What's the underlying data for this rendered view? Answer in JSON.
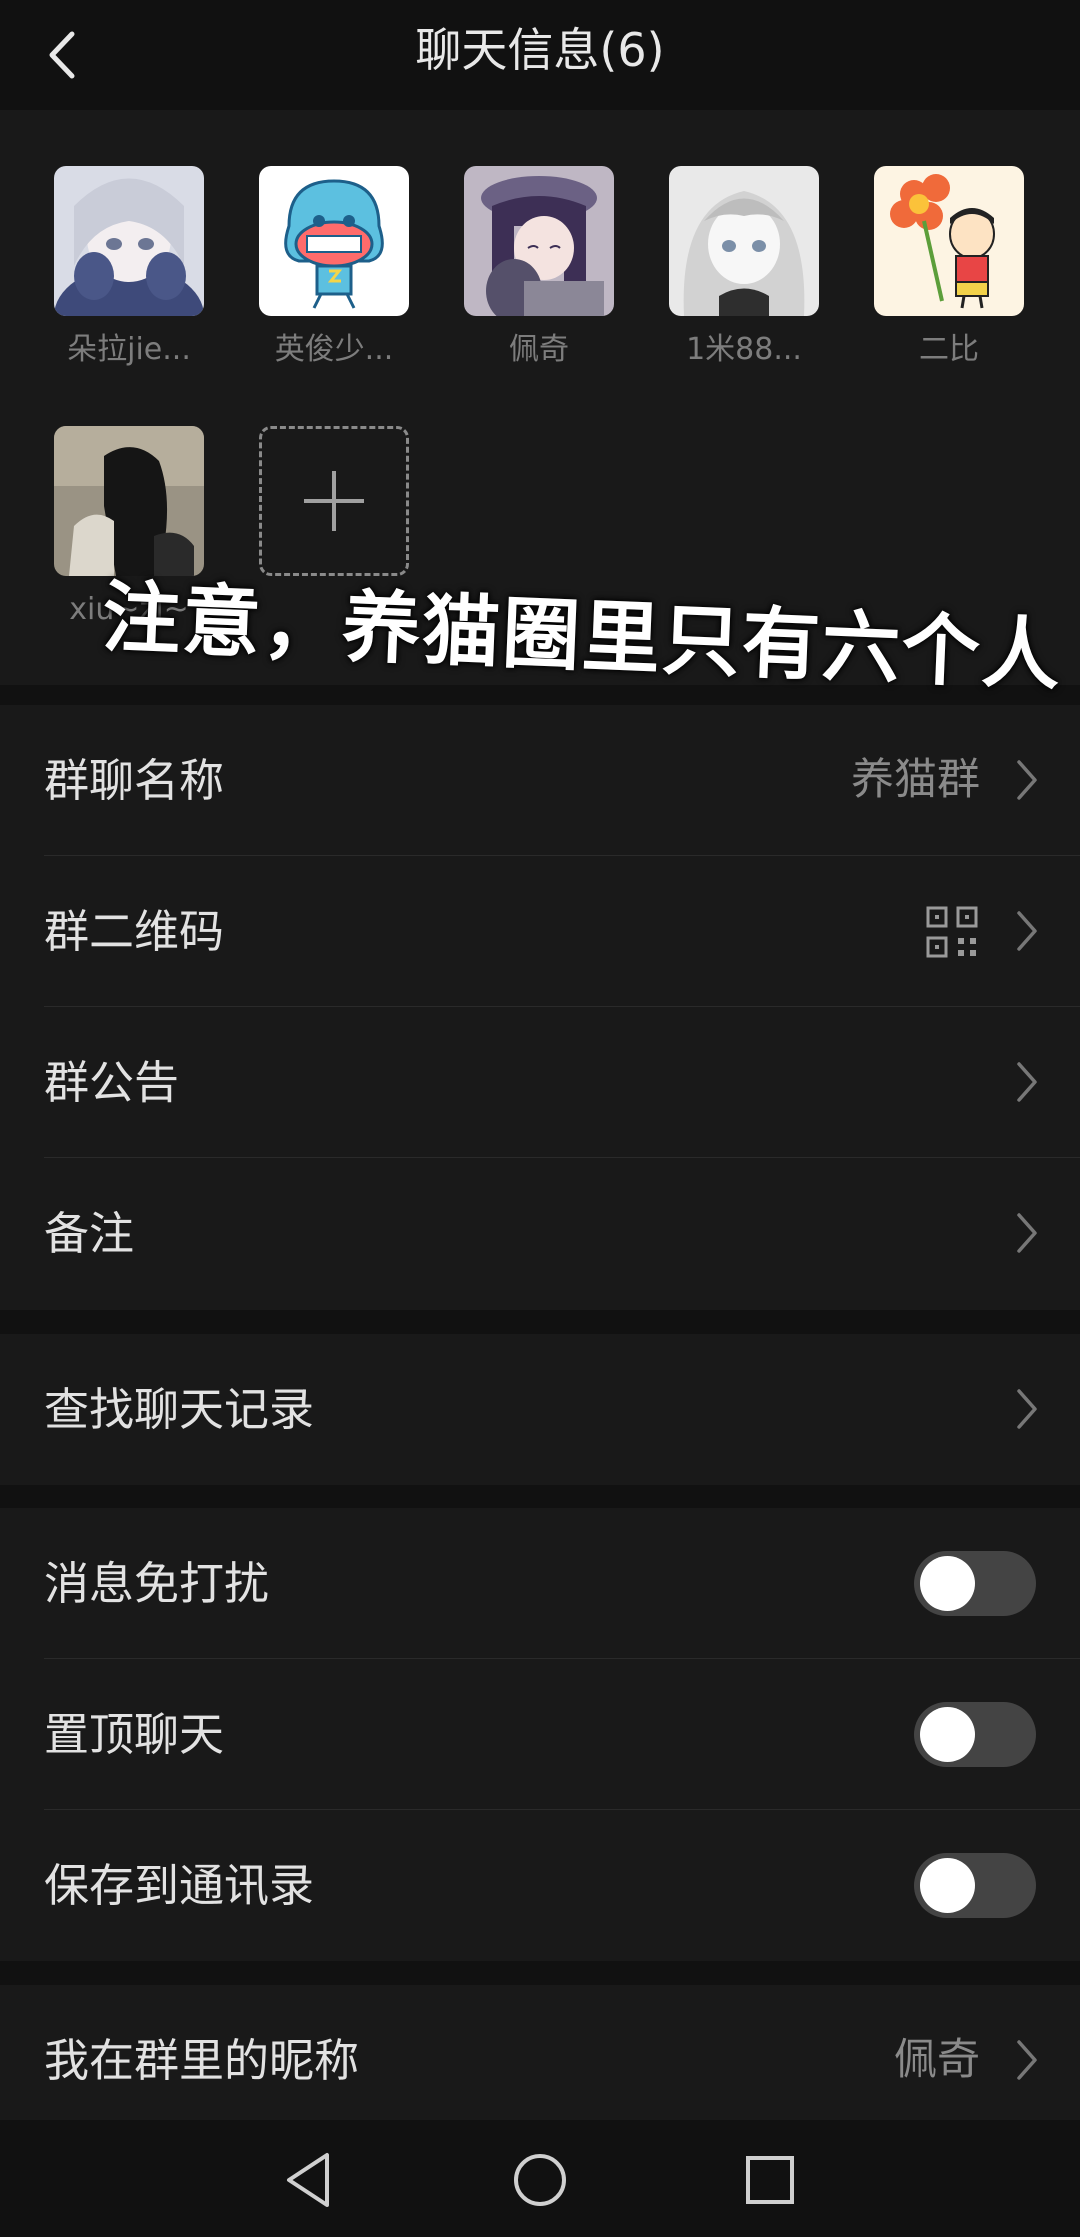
{
  "header": {
    "title": "聊天信息(6)",
    "back_icon": "chevron-left-icon"
  },
  "members": [
    {
      "name": "朵拉jie...",
      "avatar": "anime-girl-silver-hair"
    },
    {
      "name": "英俊少...",
      "avatar": "cartoon-character-blue"
    },
    {
      "name": "佩奇",
      "avatar": "anime-girl-purple-hair"
    },
    {
      "name": "1米88...",
      "avatar": "anime-girl-white-hair"
    },
    {
      "name": "二比",
      "avatar": "cartoon-boy-with-flower"
    },
    {
      "name": "xiu~zi~",
      "avatar": "girl-photo-dark-hair"
    }
  ],
  "add_member_icon": "plus-icon",
  "overlay_caption": "注意，养猫圈里只有六个人",
  "settings": {
    "group_name": {
      "label": "群聊名称",
      "value": "养猫群"
    },
    "qr_code": {
      "label": "群二维码",
      "icon": "qr-code-icon"
    },
    "announcement": {
      "label": "群公告"
    },
    "remark": {
      "label": "备注"
    },
    "search_history": {
      "label": "查找聊天记录"
    },
    "mute": {
      "label": "消息免打扰",
      "on": false
    },
    "pin": {
      "label": "置顶聊天",
      "on": false
    },
    "save_contacts": {
      "label": "保存到通讯录",
      "on": false
    },
    "my_nickname": {
      "label": "我在群里的昵称",
      "value": "佩奇"
    }
  },
  "navbar": {
    "back": "triangle-back-icon",
    "home": "circle-home-icon",
    "recents": "square-recents-icon"
  },
  "colors": {
    "background": "#111111",
    "panel": "#191919",
    "text": "#e2e2e2",
    "muted": "#8a8a8a",
    "toggle_track": "#444444"
  }
}
